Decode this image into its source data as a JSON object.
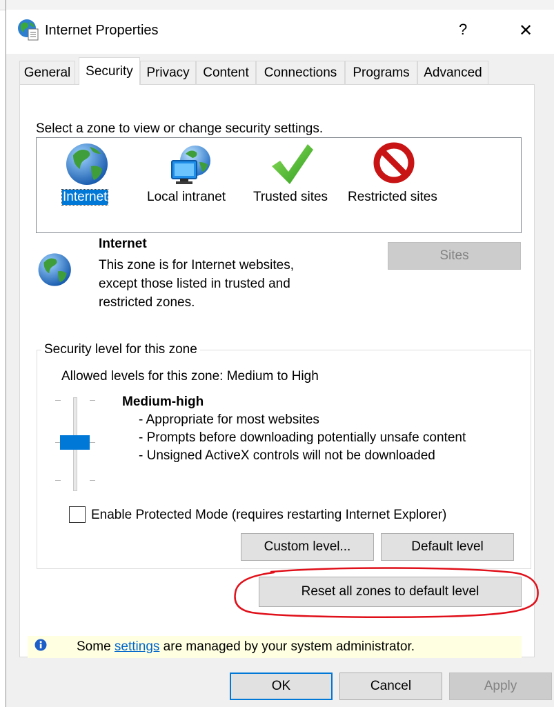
{
  "window": {
    "title": "Internet Properties",
    "help_glyph": "?",
    "close_glyph": "✕"
  },
  "tabs": [
    {
      "label": "General"
    },
    {
      "label": "Security",
      "active": true
    },
    {
      "label": "Privacy"
    },
    {
      "label": "Content"
    },
    {
      "label": "Connections"
    },
    {
      "label": "Programs"
    },
    {
      "label": "Advanced"
    }
  ],
  "security": {
    "zone_prompt": "Select a zone to view or change security settings.",
    "zones": [
      {
        "label": "Internet",
        "icon": "globe-icon",
        "selected": true
      },
      {
        "label": "Local intranet",
        "icon": "local-intranet-icon"
      },
      {
        "label": "Trusted sites",
        "icon": "checkmark-icon"
      },
      {
        "label": "Restricted sites",
        "icon": "restricted-icon"
      }
    ],
    "zone_info": {
      "title": "Internet",
      "desc_lines": [
        "This zone is for Internet websites,",
        "except those listed in trusted and",
        "restricted zones."
      ]
    },
    "sites_button": "Sites",
    "level_group": {
      "legend": "Security level for this zone",
      "allowed": "Allowed levels for this zone: Medium to High",
      "level_name": "Medium-high",
      "bullets": [
        "- Appropriate for most websites",
        "- Prompts before downloading potentially unsafe content",
        "- Unsigned ActiveX controls will not be downloaded"
      ],
      "slider_level": "Medium-high",
      "protected_mode": "Enable Protected Mode (requires restarting Internet Explorer)",
      "protected_mode_checked": false,
      "custom_level": "Custom level...",
      "default_level": "Default level"
    },
    "reset_all": "Reset all zones to default level",
    "admin_notice": {
      "before": "Some ",
      "link": "settings",
      "after": " are managed by your system administrator."
    }
  },
  "footer": {
    "ok": "OK",
    "cancel": "Cancel",
    "apply": "Apply"
  },
  "colors": {
    "accent": "#0078d7",
    "annotation_circle": "#e0101a",
    "notice_bg": "#ffffe1"
  }
}
